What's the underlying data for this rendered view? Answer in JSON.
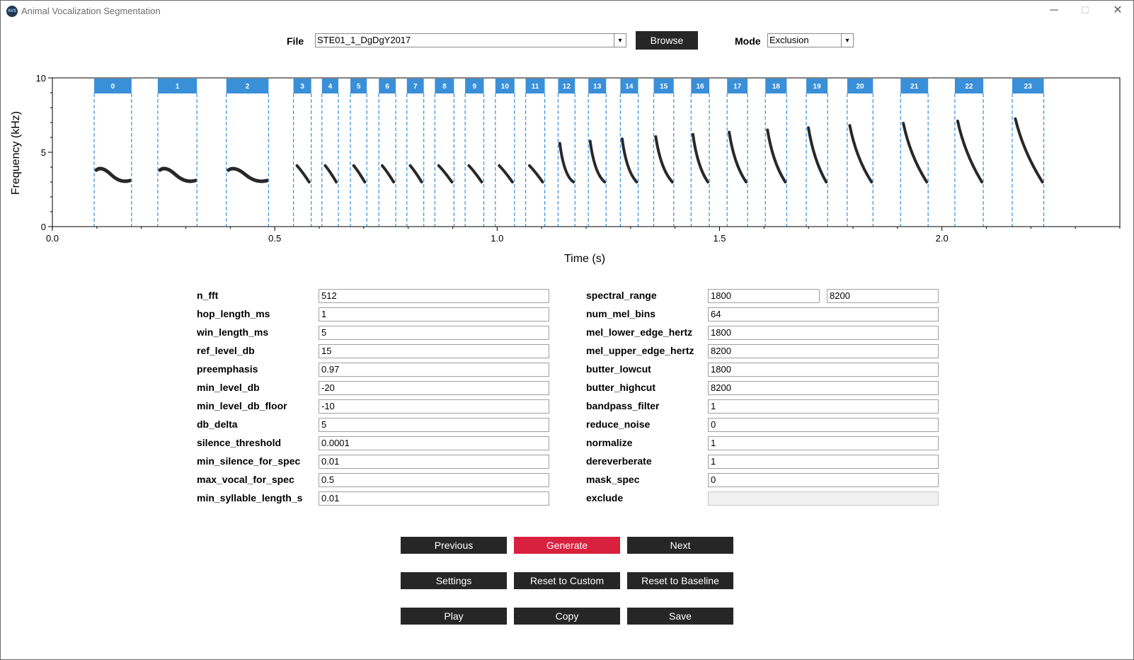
{
  "window": {
    "title": "Animal Vocalization Segmentation",
    "icon_text": "AVS",
    "minimize_glyph": "─",
    "maximize_glyph": "☐",
    "close_glyph": "✕"
  },
  "top": {
    "file_label": "File",
    "file_value": "STE01_1_DgDgY2017",
    "browse_label": "Browse",
    "mode_label": "Mode",
    "mode_value": "Exclusion",
    "dropdown_glyph": "▾"
  },
  "chart_data": {
    "type": "spectrogram-segmentation",
    "xlabel": "Time (s)",
    "ylabel": "Frequency (kHz)",
    "xlim": [
      0.0,
      2.4
    ],
    "ylim": [
      0,
      10
    ],
    "x_ticks": [
      0.0,
      0.5,
      1.0,
      1.5,
      2.0
    ],
    "x_tick_labels": [
      "0.0",
      "0.5",
      "1.0",
      "1.5",
      "2.0"
    ],
    "y_ticks": [
      0,
      5,
      10
    ],
    "y_tick_labels": [
      "0",
      "5",
      "10"
    ],
    "segment_color": "#3a8fd9",
    "segments": [
      {
        "label": "0",
        "start": 0.094,
        "end": 0.178
      },
      {
        "label": "1",
        "start": 0.237,
        "end": 0.325
      },
      {
        "label": "2",
        "start": 0.391,
        "end": 0.486
      },
      {
        "label": "3",
        "start": 0.542,
        "end": 0.582
      },
      {
        "label": "4",
        "start": 0.606,
        "end": 0.643
      },
      {
        "label": "5",
        "start": 0.67,
        "end": 0.707
      },
      {
        "label": "6",
        "start": 0.734,
        "end": 0.772
      },
      {
        "label": "7",
        "start": 0.797,
        "end": 0.835
      },
      {
        "label": "8",
        "start": 0.86,
        "end": 0.903
      },
      {
        "label": "9",
        "start": 0.928,
        "end": 0.97
      },
      {
        "label": "10",
        "start": 0.996,
        "end": 1.039
      },
      {
        "label": "11",
        "start": 1.064,
        "end": 1.107
      },
      {
        "label": "12",
        "start": 1.137,
        "end": 1.175
      },
      {
        "label": "13",
        "start": 1.205,
        "end": 1.245
      },
      {
        "label": "14",
        "start": 1.277,
        "end": 1.317
      },
      {
        "label": "15",
        "start": 1.352,
        "end": 1.397
      },
      {
        "label": "16",
        "start": 1.436,
        "end": 1.477
      },
      {
        "label": "17",
        "start": 1.517,
        "end": 1.563
      },
      {
        "label": "18",
        "start": 1.603,
        "end": 1.651
      },
      {
        "label": "19",
        "start": 1.695,
        "end": 1.743
      },
      {
        "label": "20",
        "start": 1.787,
        "end": 1.845
      },
      {
        "label": "21",
        "start": 1.907,
        "end": 1.969
      },
      {
        "label": "22",
        "start": 2.029,
        "end": 2.093
      },
      {
        "label": "23",
        "start": 2.158,
        "end": 2.229
      }
    ]
  },
  "params_left": [
    {
      "label": "n_fft",
      "value": "512"
    },
    {
      "label": "hop_length_ms",
      "value": "1"
    },
    {
      "label": "win_length_ms",
      "value": "5"
    },
    {
      "label": "ref_level_db",
      "value": "15"
    },
    {
      "label": "preemphasis",
      "value": "0.97"
    },
    {
      "label": "min_level_db",
      "value": "-20"
    },
    {
      "label": "min_level_db_floor",
      "value": "-10"
    },
    {
      "label": "db_delta",
      "value": "5"
    },
    {
      "label": "silence_threshold",
      "value": "0.0001"
    },
    {
      "label": "min_silence_for_spec",
      "value": "0.01"
    },
    {
      "label": "max_vocal_for_spec",
      "value": "0.5"
    },
    {
      "label": "min_syllable_length_s",
      "value": "0.01"
    }
  ],
  "params_right": [
    {
      "label": "spectral_range",
      "value": "1800",
      "value2": "8200"
    },
    {
      "label": "num_mel_bins",
      "value": "64"
    },
    {
      "label": "mel_lower_edge_hertz",
      "value": "1800"
    },
    {
      "label": "mel_upper_edge_hertz",
      "value": "8200"
    },
    {
      "label": "butter_lowcut",
      "value": "1800"
    },
    {
      "label": "butter_highcut",
      "value": "8200"
    },
    {
      "label": "bandpass_filter",
      "value": "1"
    },
    {
      "label": "reduce_noise",
      "value": "0"
    },
    {
      "label": "normalize",
      "value": "1"
    },
    {
      "label": "dereverberate",
      "value": "1"
    },
    {
      "label": "mask_spec",
      "value": "0"
    },
    {
      "label": "exclude",
      "value": ""
    }
  ],
  "buttons": {
    "previous": "Previous",
    "generate": "Generate",
    "next": "Next",
    "settings": "Settings",
    "reset_custom": "Reset to Custom",
    "reset_baseline": "Reset to Baseline",
    "play": "Play",
    "copy": "Copy",
    "save": "Save"
  },
  "colors": {
    "generate": "#d9203d",
    "dark_button": "#262626"
  }
}
